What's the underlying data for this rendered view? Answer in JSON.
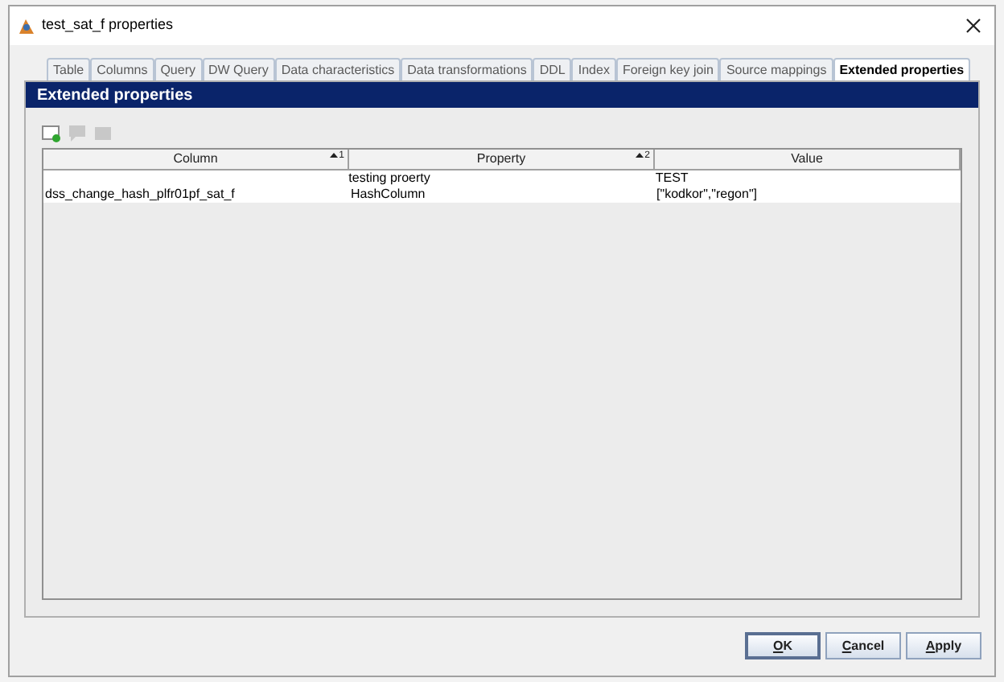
{
  "window": {
    "title": "test_sat_f properties"
  },
  "tabs": [
    {
      "label": "Table",
      "selected": false
    },
    {
      "label": "Columns",
      "selected": false
    },
    {
      "label": "Query",
      "selected": false
    },
    {
      "label": "DW Query",
      "selected": false
    },
    {
      "label": "Data characteristics",
      "selected": false
    },
    {
      "label": "Data transformations",
      "selected": false
    },
    {
      "label": "DDL",
      "selected": false
    },
    {
      "label": "Index",
      "selected": false
    },
    {
      "label": "Foreign key join",
      "selected": false
    },
    {
      "label": "Source mappings",
      "selected": false
    },
    {
      "label": "Extended properties",
      "selected": true
    }
  ],
  "panel": {
    "title": "Extended properties"
  },
  "toolbar": [
    {
      "kind": "add",
      "disabled": false
    },
    {
      "kind": "edit",
      "disabled": true
    },
    {
      "kind": "delete",
      "disabled": true
    }
  ],
  "table": {
    "columns": [
      {
        "label": "Column",
        "sort_order": "1"
      },
      {
        "label": "Property",
        "sort_order": "2"
      },
      {
        "label": "Value"
      }
    ],
    "rows": [
      [
        null,
        "testing proerty",
        "TEST"
      ],
      [
        "dss_change_hash_plfr01pf_sat_f",
        "HashColumn",
        "[\"kodkor\",\"regon\"]"
      ]
    ]
  },
  "buttons": [
    {
      "label": "OK",
      "default": true,
      "mnemonic_underlined": true
    },
    {
      "label": "Cancel",
      "default": false,
      "mnemonic_underlined": true
    },
    {
      "label": "Apply",
      "default": false,
      "mnemonic_underlined": true
    }
  ]
}
